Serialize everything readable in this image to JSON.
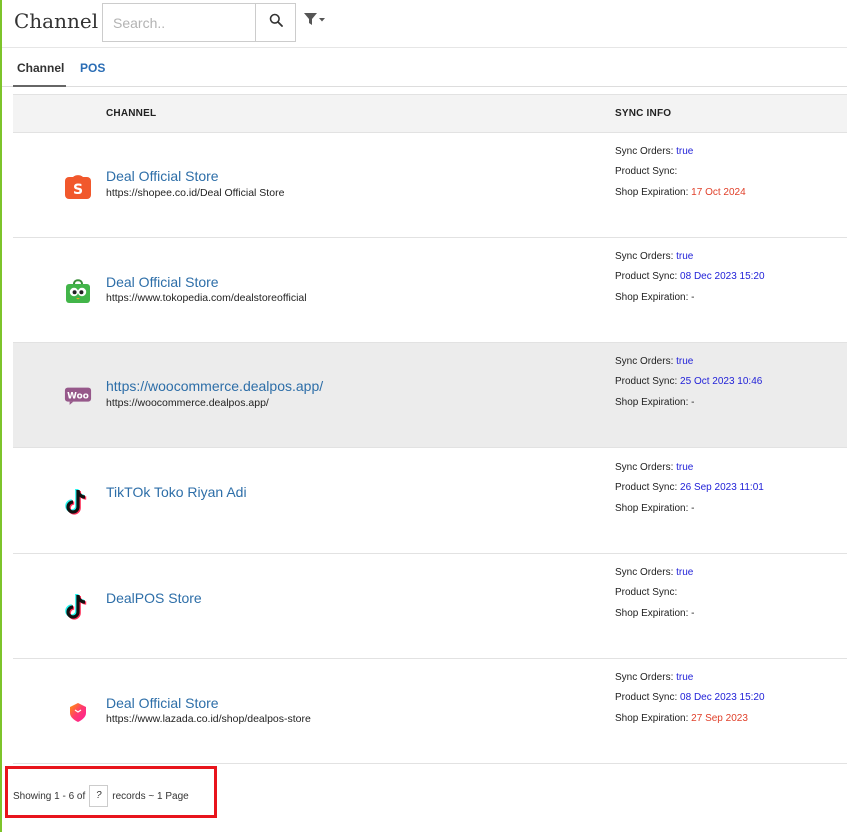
{
  "header": {
    "title": "Channel",
    "search_placeholder": "Search..",
    "search_icon": "search-icon",
    "filter_icon": "filter-icon"
  },
  "tabs": [
    {
      "label": "Channel",
      "active": true
    },
    {
      "label": "POS",
      "active": false
    }
  ],
  "table": {
    "columns": [
      "CHANNEL",
      "SYNC INFO"
    ],
    "sync_labels": {
      "orders": "Sync Orders:",
      "product": "Product Sync:",
      "expiration": "Shop Expiration:"
    },
    "rows": [
      {
        "icon": "shopee-icon",
        "name": "Deal Official Store",
        "url": "https://shopee.co.id/Deal Official Store",
        "sync_orders": "true",
        "product_sync": "",
        "shop_expiration": "17 Oct 2024",
        "highlight": false
      },
      {
        "icon": "tokopedia-icon",
        "name": "Deal Official Store",
        "url": "https://www.tokopedia.com/dealstoreofficial",
        "sync_orders": "true",
        "product_sync": "08 Dec 2023 15:20",
        "shop_expiration": "-",
        "highlight": false
      },
      {
        "icon": "woocommerce-icon",
        "name": "https://woocommerce.dealpos.app/",
        "url": "https://woocommerce.dealpos.app/",
        "sync_orders": "true",
        "product_sync": "25 Oct 2023 10:46",
        "shop_expiration": "-",
        "highlight": true
      },
      {
        "icon": "tiktok-icon",
        "name": "TikTOk Toko Riyan Adi",
        "url": "",
        "sync_orders": "true",
        "product_sync": "26 Sep 2023 11:01",
        "shop_expiration": "-",
        "highlight": false
      },
      {
        "icon": "tiktok-icon",
        "name": "DealPOS Store",
        "url": "",
        "sync_orders": "true",
        "product_sync": "",
        "shop_expiration": "-",
        "highlight": false
      },
      {
        "icon": "lazada-icon",
        "name": "Deal Official Store",
        "url": "https://www.lazada.co.id/shop/dealpos-store",
        "sync_orders": "true",
        "product_sync": "08 Dec 2023 15:20",
        "shop_expiration": "27 Sep 2023",
        "highlight": false
      }
    ]
  },
  "footer": {
    "showing": "Showing 1 - 6 of",
    "total": "?",
    "suffix": "records ~ 1 Page"
  },
  "colors": {
    "accent_bar": "#7dc42a",
    "link": "#2d6ea8",
    "sync_value": "#2222d8",
    "expired": "#e0402a",
    "footer_highlight": "#e8141c"
  }
}
